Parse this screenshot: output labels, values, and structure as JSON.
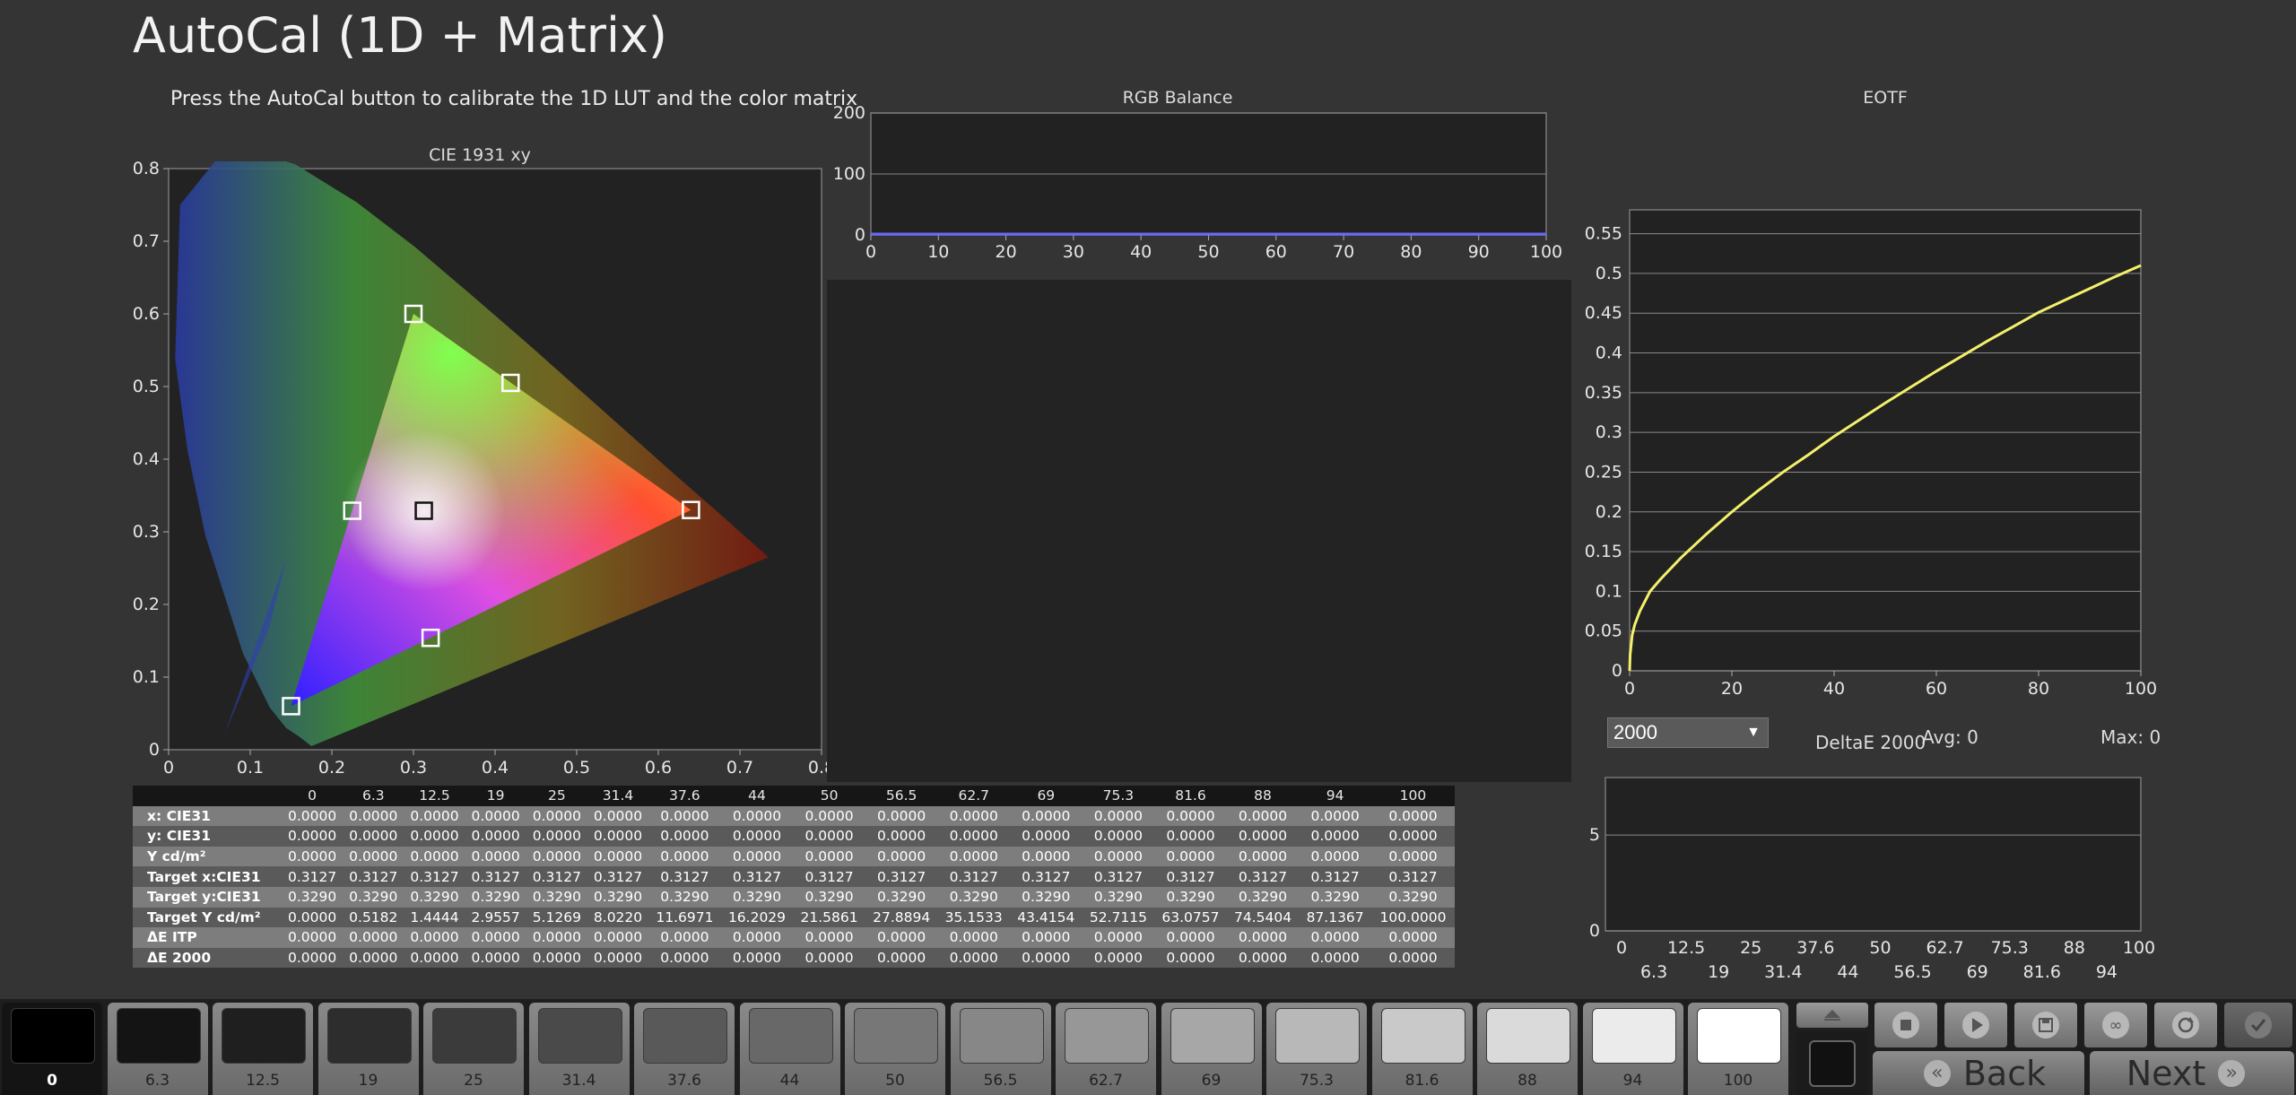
{
  "page": {
    "title": "AutoCal (1D + Matrix)",
    "instructions": "Press the AutoCal button to calibrate the 1D LUT and the color matrix"
  },
  "colors": {
    "background": "#343434",
    "plot_bg": "#222222",
    "eotf_curve": "#f4f06a",
    "rgb_line": "#6a6aff"
  },
  "chart_data": [
    {
      "type": "scatter",
      "title": "CIE 1931 xy",
      "xlim": [
        0,
        0.8
      ],
      "ylim": [
        0,
        0.8
      ],
      "x_ticks": [
        "0",
        "0.1",
        "0.2",
        "0.3",
        "0.4",
        "0.5",
        "0.6",
        "0.7",
        "0.8"
      ],
      "y_ticks": [
        "0",
        "0.1",
        "0.2",
        "0.3",
        "0.4",
        "0.5",
        "0.6",
        "0.7",
        "0.8"
      ],
      "gamut": [
        [
          0.708,
          0.292
        ],
        [
          0.17,
          0.797
        ],
        [
          0.131,
          0.046
        ]
      ],
      "target_triangle": [
        [
          0.64,
          0.33
        ],
        [
          0.3,
          0.6
        ],
        [
          0.15,
          0.06
        ]
      ],
      "targets": [
        {
          "name": "Red",
          "x": 0.64,
          "y": 0.33
        },
        {
          "name": "Green",
          "x": 0.3,
          "y": 0.6
        },
        {
          "name": "Blue",
          "x": 0.15,
          "y": 0.06
        },
        {
          "name": "Yellow",
          "x": 0.419,
          "y": 0.505
        },
        {
          "name": "Cyan",
          "x": 0.225,
          "y": 0.329
        },
        {
          "name": "Magenta",
          "x": 0.321,
          "y": 0.154
        },
        {
          "name": "White",
          "x": 0.3127,
          "y": 0.329
        }
      ]
    },
    {
      "type": "line",
      "title": "RGB Balance",
      "xlim": [
        0,
        100
      ],
      "ylim": [
        0,
        200
      ],
      "x_ticks": [
        "0",
        "10",
        "20",
        "30",
        "40",
        "50",
        "60",
        "70",
        "80",
        "90",
        "100"
      ],
      "y_ticks": [
        "0",
        "100",
        "200"
      ],
      "series": [
        {
          "values": [
            [
              0,
              0
            ],
            [
              100,
              0
            ]
          ]
        }
      ]
    },
    {
      "type": "line",
      "title": "EOTF",
      "xlim": [
        0,
        100
      ],
      "ylim": [
        0,
        0.58
      ],
      "x_ticks": [
        "0",
        "20",
        "40",
        "60",
        "80",
        "100"
      ],
      "y_ticks": [
        "0",
        "0.05",
        "0.1",
        "0.15",
        "0.2",
        "0.25",
        "0.3",
        "0.35",
        "0.4",
        "0.45",
        "0.5",
        "0.55"
      ],
      "series": [
        {
          "values": [
            [
              0,
              0
            ],
            [
              0.1,
              0.02
            ],
            [
              0.5,
              0.045
            ],
            [
              1,
              0.058
            ],
            [
              2,
              0.075
            ],
            [
              4,
              0.1
            ],
            [
              6,
              0.115
            ],
            [
              10,
              0.142
            ],
            [
              15,
              0.172
            ],
            [
              20,
              0.2
            ],
            [
              25,
              0.226
            ],
            [
              30,
              0.25
            ],
            [
              35,
              0.272
            ],
            [
              40,
              0.295
            ],
            [
              45,
              0.316
            ],
            [
              50,
              0.337
            ],
            [
              55,
              0.357
            ],
            [
              60,
              0.377
            ],
            [
              65,
              0.396
            ],
            [
              70,
              0.415
            ],
            [
              75,
              0.433
            ],
            [
              80,
              0.451
            ],
            [
              85,
              0.466
            ],
            [
              90,
              0.481
            ],
            [
              95,
              0.496
            ],
            [
              100,
              0.51
            ]
          ]
        }
      ]
    },
    {
      "type": "bar",
      "title": "DeltaE 2000",
      "ylim": [
        0,
        8
      ],
      "y_ticks": [
        "0",
        "5"
      ],
      "categories": [
        "0",
        "6.3",
        "12.5",
        "19",
        "25",
        "31.4",
        "37.6",
        "44",
        "50",
        "56.5",
        "62.7",
        "69",
        "75.3",
        "81.6",
        "88",
        "94",
        "100"
      ],
      "values": [
        0,
        0,
        0,
        0,
        0,
        0,
        0,
        0,
        0,
        0,
        0,
        0,
        0,
        0,
        0,
        0,
        0
      ]
    }
  ],
  "deltae": {
    "select_value": "2000",
    "title": "DeltaE 2000",
    "avg": "Avg: 0",
    "max": "Max: 0"
  },
  "table": {
    "headers": [
      "0",
      "6.3",
      "12.5",
      "19",
      "25",
      "31.4",
      "37.6",
      "44",
      "50",
      "56.5",
      "62.7",
      "69",
      "75.3",
      "81.6",
      "88",
      "94",
      "100"
    ],
    "rows": [
      {
        "label": "x: CIE31",
        "values": [
          "0.0000",
          "0.0000",
          "0.0000",
          "0.0000",
          "0.0000",
          "0.0000",
          "0.0000",
          "0.0000",
          "0.0000",
          "0.0000",
          "0.0000",
          "0.0000",
          "0.0000",
          "0.0000",
          "0.0000",
          "0.0000",
          "0.0000"
        ]
      },
      {
        "label": "y: CIE31",
        "values": [
          "0.0000",
          "0.0000",
          "0.0000",
          "0.0000",
          "0.0000",
          "0.0000",
          "0.0000",
          "0.0000",
          "0.0000",
          "0.0000",
          "0.0000",
          "0.0000",
          "0.0000",
          "0.0000",
          "0.0000",
          "0.0000",
          "0.0000"
        ]
      },
      {
        "label": "Y cd/m²",
        "values": [
          "0.0000",
          "0.0000",
          "0.0000",
          "0.0000",
          "0.0000",
          "0.0000",
          "0.0000",
          "0.0000",
          "0.0000",
          "0.0000",
          "0.0000",
          "0.0000",
          "0.0000",
          "0.0000",
          "0.0000",
          "0.0000",
          "0.0000"
        ]
      },
      {
        "label": "Target x:CIE31",
        "values": [
          "0.3127",
          "0.3127",
          "0.3127",
          "0.3127",
          "0.3127",
          "0.3127",
          "0.3127",
          "0.3127",
          "0.3127",
          "0.3127",
          "0.3127",
          "0.3127",
          "0.3127",
          "0.3127",
          "0.3127",
          "0.3127",
          "0.3127"
        ]
      },
      {
        "label": "Target y:CIE31",
        "values": [
          "0.3290",
          "0.3290",
          "0.3290",
          "0.3290",
          "0.3290",
          "0.3290",
          "0.3290",
          "0.3290",
          "0.3290",
          "0.3290",
          "0.3290",
          "0.3290",
          "0.3290",
          "0.3290",
          "0.3290",
          "0.3290",
          "0.3290"
        ]
      },
      {
        "label": "Target Y cd/m²",
        "values": [
          "0.0000",
          "0.5182",
          "1.4444",
          "2.9557",
          "5.1269",
          "8.0220",
          "11.6971",
          "16.2029",
          "21.5861",
          "27.8894",
          "35.1533",
          "43.4154",
          "52.7115",
          "63.0757",
          "74.5404",
          "87.1367",
          "100.0000"
        ]
      },
      {
        "label": "ΔE ITP",
        "values": [
          "0.0000",
          "0.0000",
          "0.0000",
          "0.0000",
          "0.0000",
          "0.0000",
          "0.0000",
          "0.0000",
          "0.0000",
          "0.0000",
          "0.0000",
          "0.0000",
          "0.0000",
          "0.0000",
          "0.0000",
          "0.0000",
          "0.0000"
        ]
      },
      {
        "label": "ΔE 2000",
        "values": [
          "0.0000",
          "0.0000",
          "0.0000",
          "0.0000",
          "0.0000",
          "0.0000",
          "0.0000",
          "0.0000",
          "0.0000",
          "0.0000",
          "0.0000",
          "0.0000",
          "0.0000",
          "0.0000",
          "0.0000",
          "0.0000",
          "0.0000"
        ]
      }
    ]
  },
  "swatches": [
    {
      "label": "0",
      "color": "#000000",
      "selected": true
    },
    {
      "label": "6.3",
      "color": "#141414"
    },
    {
      "label": "12.5",
      "color": "#1f1f1f"
    },
    {
      "label": "19",
      "color": "#2d2d2d"
    },
    {
      "label": "25",
      "color": "#3b3b3b"
    },
    {
      "label": "31.4",
      "color": "#4a4a4a"
    },
    {
      "label": "37.6",
      "color": "#595959"
    },
    {
      "label": "44",
      "color": "#686868"
    },
    {
      "label": "50",
      "color": "#777777"
    },
    {
      "label": "56.5",
      "color": "#878787"
    },
    {
      "label": "62.7",
      "color": "#979797"
    },
    {
      "label": "69",
      "color": "#a7a7a7"
    },
    {
      "label": "75.3",
      "color": "#b8b8b8"
    },
    {
      "label": "81.6",
      "color": "#c9c9c9"
    },
    {
      "label": "88",
      "color": "#dadada"
    },
    {
      "label": "94",
      "color": "#ebebeb"
    },
    {
      "label": "100",
      "color": "#ffffff"
    }
  ],
  "controls": {
    "icons": [
      "eject-icon",
      "stop-icon",
      "play-icon",
      "save-icon",
      "loop-icon",
      "refresh-icon",
      "check-icon"
    ],
    "back_label": "Back",
    "next_label": "Next"
  }
}
